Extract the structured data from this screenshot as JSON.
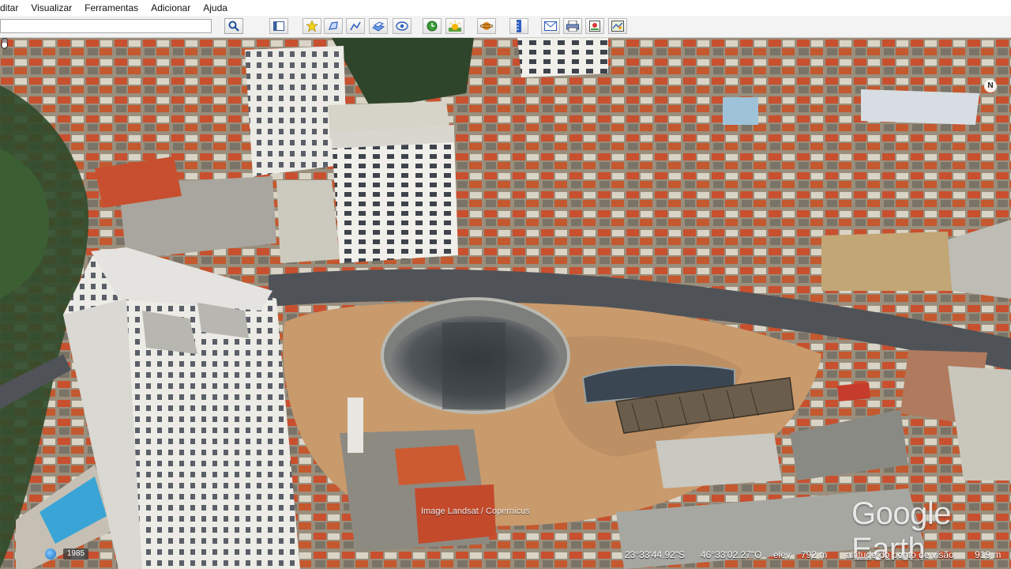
{
  "menu": {
    "items": [
      "ditar",
      "Visualizar",
      "Ferramentas",
      "Adicionar",
      "Ajuda"
    ]
  },
  "toolbar": {
    "search_value": "",
    "icons": [
      "sidebar-toggle-icon",
      "placemark-icon",
      "polygon-icon",
      "path-icon",
      "image-overlay-icon",
      "record-tour-icon",
      "historical-imagery-icon",
      "sun-icon",
      "planets-icon",
      "ruler-icon",
      "email-icon",
      "print-icon",
      "save-image-icon",
      "view-in-maps-icon"
    ]
  },
  "map": {
    "watermark": "Google Earth",
    "attribution": "Image Landsat / Copernicus",
    "compass_label": "N"
  },
  "status": {
    "year": "1985",
    "latitude": "23°33'44.92\"S",
    "longitude": "46°33'02.27\"O",
    "elev_label": "elev",
    "elev_value": "792 m",
    "eye_alt_label": "altitude do ponto de visão",
    "eye_alt_value": "919 m"
  }
}
